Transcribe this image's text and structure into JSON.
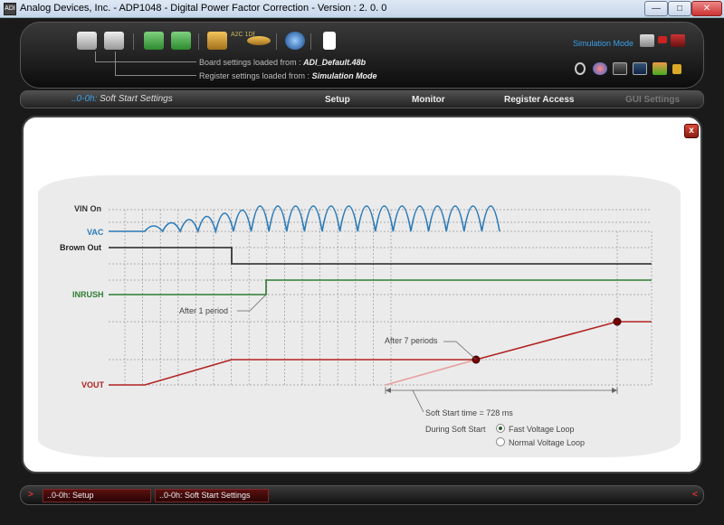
{
  "window": {
    "app_icon": "ADI",
    "title": "Analog Devices, Inc. - ADP1048 - Digital Power Factor Correction - Version : 2. 0. 0",
    "min": "—",
    "max": "□",
    "close": "✕"
  },
  "toolbar": {
    "icons": [
      "printer-read-icon",
      "printer-write-icon",
      "board-read-icon",
      "board-write-icon",
      "tools-icon",
      "adc-converter-icon",
      "globe-icon",
      "document-icon"
    ],
    "adc_text": "A2C 1Df",
    "board_label": "Board settings loaded from : ",
    "board_value": "ADI_Default.48b",
    "register_label": "Register settings loaded from : ",
    "register_value": "Simulation Mode",
    "simulation_mode": "Simulation Mode",
    "right_icons": [
      "computer-icon",
      "usb-connector-icon",
      "adapter-icon",
      "search-icon",
      "color-icon",
      "chip-icon",
      "save-icon",
      "export-icon",
      "lock-icon"
    ]
  },
  "nav": {
    "crumb_code": "..0-0h:",
    "crumb_title": " Soft Start Settings",
    "items": [
      "Setup",
      "Monitor",
      "Register Access",
      "GUI Settings"
    ]
  },
  "panel": {
    "close": "x",
    "signals": {
      "vin_on": "VIN On",
      "vac": "VAC",
      "brown_out": "Brown Out",
      "inrush": "INRUSH",
      "vout": "VOUT"
    },
    "annotations": {
      "after_1": "After 1 period",
      "after_7": "After 7 periods",
      "soft_start_time": "Soft Start time = 728 ms",
      "during": "During Soft Start"
    },
    "loop_options": [
      {
        "label": "Fast Voltage Loop",
        "selected": true
      },
      {
        "label": "Normal Voltage Loop",
        "selected": false
      }
    ]
  },
  "colors": {
    "vac": "#2a7ab8",
    "brown_out": "#222222",
    "inrush": "#2e7d32",
    "vout": "#b22222",
    "accent": "#3aa0e8"
  },
  "bottom": {
    "left_arrow": ">",
    "right_arrow": "<",
    "tabs": [
      "..0-0h: Setup",
      "..0-0h: Soft Start Settings"
    ]
  }
}
